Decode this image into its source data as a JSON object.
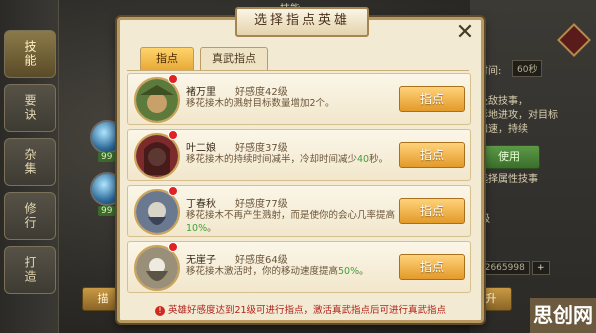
{
  "left_nav": {
    "items": [
      {
        "label": "技能",
        "active": true
      },
      {
        "label": "要诀",
        "active": false
      },
      {
        "label": "杂集",
        "active": false
      },
      {
        "label": "修行",
        "active": false
      },
      {
        "label": "打造",
        "active": false
      }
    ],
    "orb_levels": [
      "99",
      "99"
    ]
  },
  "background": {
    "top_title_fragment": "技能",
    "right": {
      "time_label": "时间:",
      "time_value": "60秒",
      "text_lines": [
        "处敌技事，",
        "形地进攻，对目标",
        "加速，持续"
      ],
      "green_button": "使用",
      "list_label": "选择属性技事",
      "level_value": "级",
      "value_box": "12665998",
      "plus": "+"
    },
    "bottom_left_button": "描",
    "bottom_right_button": "升",
    "watermark": "思创网"
  },
  "modal": {
    "title": "选择指点英雄",
    "close_glyph": "✕",
    "tabs": [
      {
        "label": "指点",
        "active": true
      },
      {
        "label": "真武指点",
        "active": false
      }
    ],
    "rows": [
      {
        "name": "褚万里",
        "favor": "好感度42级",
        "desc_pre": "移花接木的溅射目标数量增加2个。",
        "desc_green": "",
        "desc_post": "",
        "button": "指点",
        "avatar_colors": [
          "#5d7a3d",
          "#3e4f22",
          "#c8a06a"
        ]
      },
      {
        "name": "叶二娘",
        "favor": "好感度37级",
        "desc_pre": "移花接木的持续时间减半，冷却时间减少",
        "desc_green": "40",
        "desc_post": "秒。",
        "button": "指点",
        "avatar_colors": [
          "#7c2a2a",
          "#3b1818",
          "#e6b8a0"
        ]
      },
      {
        "name": "丁春秋",
        "favor": "好感度77级",
        "desc_pre": "移花接木不再产生溅射，而是使你的会心几率提高",
        "desc_green": "10%",
        "desc_post": "。",
        "button": "指点",
        "avatar_colors": [
          "#6a7890",
          "#3b4356",
          "#d9d4c8"
        ]
      },
      {
        "name": "无崖子",
        "favor": "好感度64级",
        "desc_pre": "移花接木激活时，你的移动速度提高",
        "desc_green": "50%",
        "desc_post": "。",
        "button": "指点",
        "avatar_colors": [
          "#9a8f78",
          "#5b5444",
          "#eeeae0"
        ]
      }
    ],
    "footer": "英雄好感度达到21级可进行指点，激活真武指点后可进行真武指点",
    "footer_icon": "!"
  }
}
